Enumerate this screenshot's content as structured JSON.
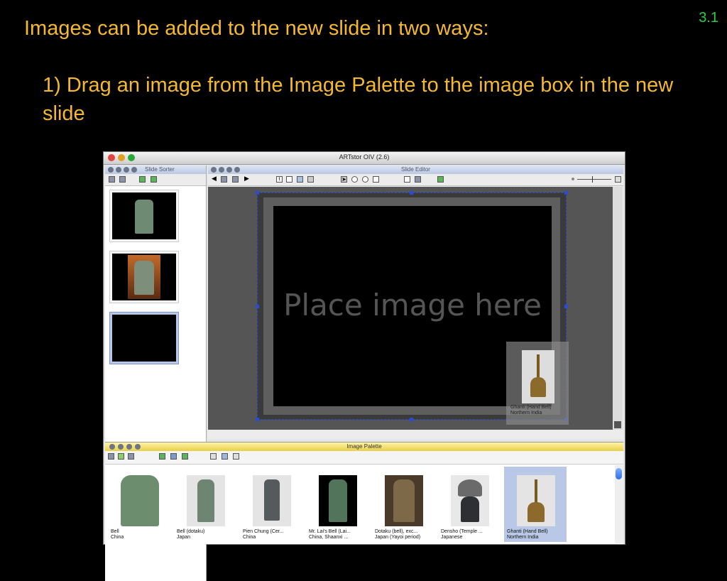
{
  "slide_number": "3.1",
  "heading": "Images can be added to the new slide in two ways:",
  "bullet": "1) Drag an image from the Image Palette to the image box in the new slide",
  "window": {
    "title": "ARTstor OIV (2.6)",
    "slide_sorter": {
      "title": "Slide Sorter"
    },
    "slide_editor": {
      "title": "Slide Editor",
      "placeholder": "Place image here",
      "dragged_image": {
        "caption_line1": "Ghanti (Hand Bell)",
        "caption_line2": "Northern India"
      }
    },
    "image_palette": {
      "title": "Image Palette",
      "items": [
        {
          "line1": "Bell",
          "line2": "China"
        },
        {
          "line1": "Bell (dotaku)",
          "line2": "Japan"
        },
        {
          "line1": "Pien Chung (Cer...",
          "line2": "China"
        },
        {
          "line1": "Mr. Lai's Bell (Lai...",
          "line2": "China, Shaanxi ..."
        },
        {
          "line1": "Dotaku (bell), exc...",
          "line2": "Japan (Yayoi period)"
        },
        {
          "line1": "Densho (Temple ...",
          "line2": "Japanese"
        },
        {
          "line1": "Ghanti (Hand Bell)",
          "line2": "Northern India"
        }
      ]
    }
  },
  "colors": {
    "text_accent": "#f5b82e",
    "slide_number": "#2ecc40",
    "selection": "#2a4bd8"
  }
}
